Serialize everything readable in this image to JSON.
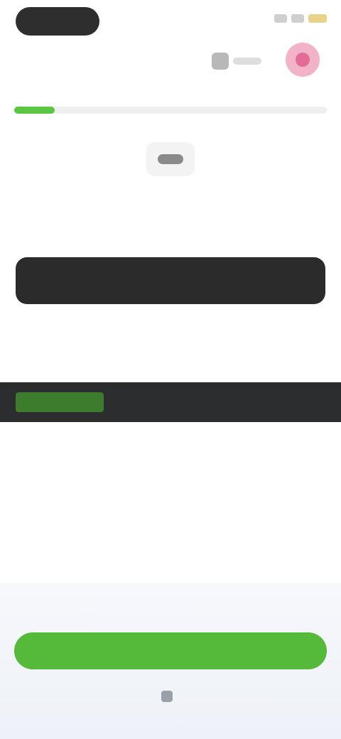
{
  "status_bar": {
    "time": "",
    "icons": [
      "signal-icon",
      "wifi-icon",
      "battery-icon"
    ]
  },
  "header": {
    "info_icon": "gem-icon",
    "info_text": "",
    "avatar_icon": "user-avatar-icon"
  },
  "progress": {
    "fraction": 0.13
  },
  "question": {
    "icon": "question-icon",
    "text": ""
  },
  "code": {
    "keyword": "",
    "text": ""
  },
  "hint": {
    "text": ""
  },
  "output": {
    "tag": "",
    "text": ""
  },
  "bottom": {
    "attempts": "",
    "check_label": "",
    "report_label": ""
  },
  "colors": {
    "accent": "#55b93a",
    "dark": "#2b2b2b",
    "avatar": "#f2b3c8"
  }
}
